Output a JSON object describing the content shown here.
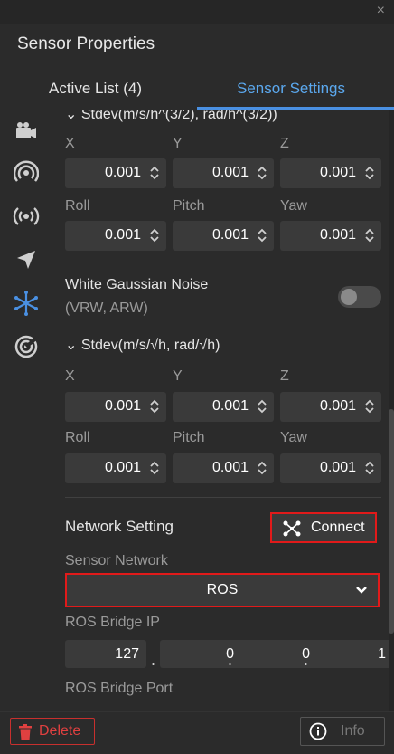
{
  "window": {
    "title": "Sensor Properties",
    "close_glyph": "×"
  },
  "tabs": [
    {
      "label": "Active List",
      "count": "(4)"
    },
    {
      "label": "Sensor Settings"
    }
  ],
  "sidebar": {
    "items": [
      {
        "icon": "camera-icon"
      },
      {
        "icon": "radar-icon"
      },
      {
        "icon": "broadcast-icon"
      },
      {
        "icon": "navigation-arrow-icon"
      },
      {
        "icon": "imu-icon",
        "active": true
      },
      {
        "icon": "target-icon"
      }
    ]
  },
  "stdev_section_1": {
    "label": "Stdev(m/s/h^(3/2), rad/h^(3/2))",
    "fields": [
      {
        "label": "X",
        "value": "0.001"
      },
      {
        "label": "Y",
        "value": "0.001"
      },
      {
        "label": "Z",
        "value": "0.001"
      },
      {
        "label": "Roll",
        "value": "0.001"
      },
      {
        "label": "Pitch",
        "value": "0.001"
      },
      {
        "label": "Yaw",
        "value": "0.001"
      }
    ]
  },
  "white_noise": {
    "title": "White Gaussian Noise",
    "subtitle": "(VRW, ARW)",
    "enabled": false,
    "stdev_label": "Stdev(m/s/√h, rad/√h)",
    "fields": [
      {
        "label": "X",
        "value": "0.001"
      },
      {
        "label": "Y",
        "value": "0.001"
      },
      {
        "label": "Z",
        "value": "0.001"
      },
      {
        "label": "Roll",
        "value": "0.001"
      },
      {
        "label": "Pitch",
        "value": "0.001"
      },
      {
        "label": "Yaw",
        "value": "0.001"
      }
    ]
  },
  "network": {
    "title": "Network Setting",
    "connect_label": "Connect",
    "sensor_network_label": "Sensor Network",
    "sensor_network_value": "ROS",
    "bridge_ip_label": "ROS Bridge IP",
    "bridge_ip": [
      "127",
      "0",
      "0",
      "1"
    ],
    "ip_separator": ".",
    "bridge_port_label": "ROS Bridge Port"
  },
  "footer": {
    "delete_label": "Delete",
    "info_label": "Info"
  },
  "colors": {
    "accent": "#4a90e2",
    "highlight_border": "#e11a1a",
    "delete": "#e04040"
  }
}
